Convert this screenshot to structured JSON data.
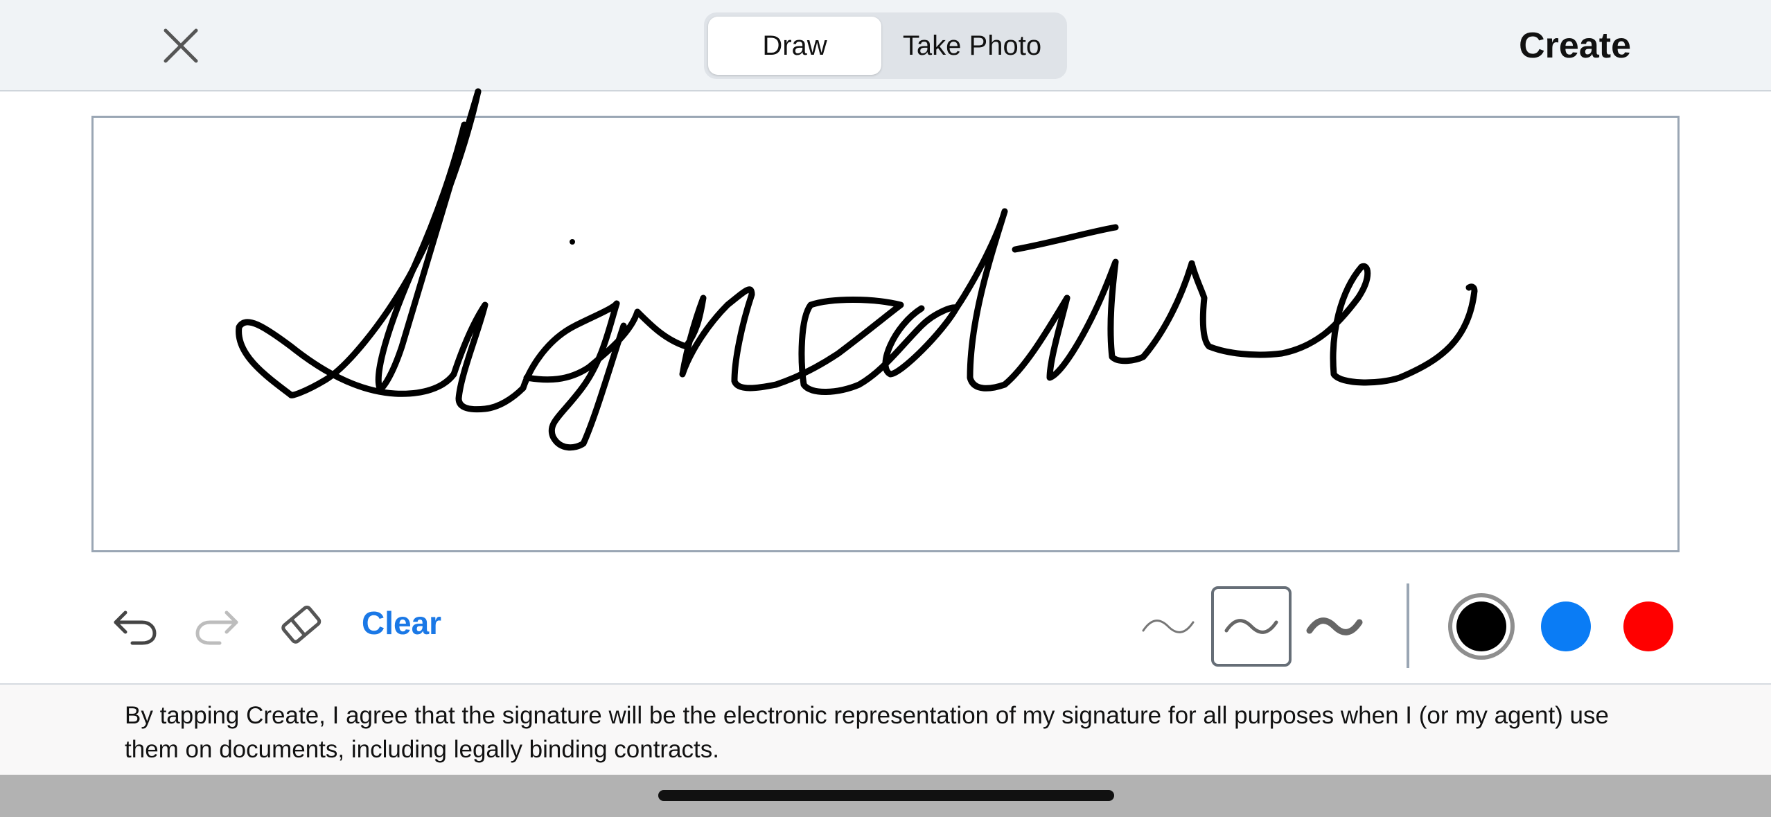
{
  "header": {
    "close_icon": "close-icon",
    "tabs": [
      {
        "label": "Draw",
        "active": true
      },
      {
        "label": "Take Photo",
        "active": false
      }
    ],
    "create_label": "Create"
  },
  "toolbar": {
    "undo_icon": "undo-icon",
    "redo_icon": "redo-icon",
    "redo_enabled": false,
    "eraser_icon": "eraser-icon",
    "clear_label": "Clear",
    "stroke_widths": [
      "thin",
      "medium",
      "thick"
    ],
    "selected_stroke": "medium",
    "colors": [
      "#000000",
      "#0a7cf5",
      "#ff0000"
    ],
    "selected_color": "#000000"
  },
  "canvas": {
    "signature_ink_color": "#000000"
  },
  "disclaimer": {
    "text": "By tapping Create, I agree that the signature will be the electronic representation of my signature for all purposes when I (or my agent) use them on documents, including legally binding contracts."
  },
  "colors": {
    "accent": "#1a78e6",
    "topbar_bg": "#f0f3f6",
    "border": "#9aa6b4"
  }
}
